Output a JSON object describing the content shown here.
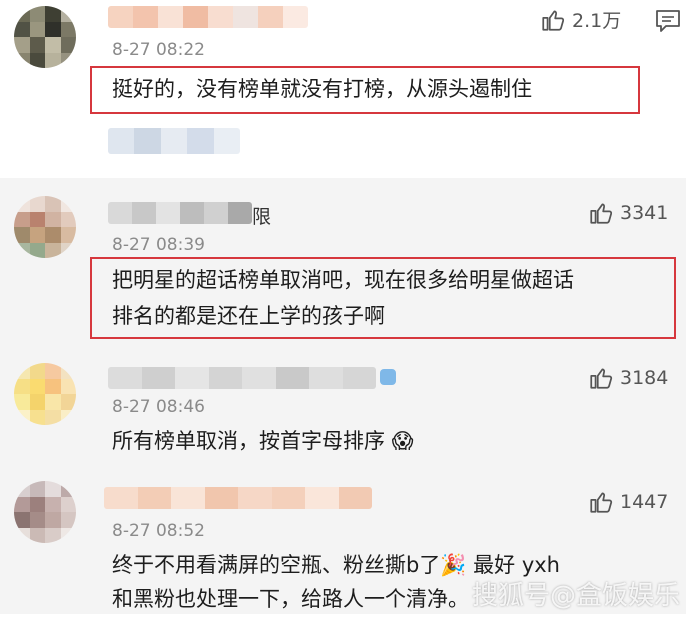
{
  "comments": [
    {
      "time": "8-27 08:22",
      "likes": "2.1万",
      "text_lines": [
        "挺好的，没有榜单就没有打榜，从源头遏制住"
      ]
    },
    {
      "time": "8-27 08:39",
      "likes": "3341",
      "name_suffix": "限",
      "text_lines": [
        "把明星的超话榜单取消吧，现在很多给明星做超话",
        "排名的都是还在上学的孩子啊"
      ]
    },
    {
      "time": "8-27 08:46",
      "likes": "3184",
      "text_lines": [
        "所有榜单取消，按首字母排序 😱"
      ]
    },
    {
      "time": "8-27 08:52",
      "likes": "1447",
      "text_lines": [
        "终于不用看满屏的空瓶、粉丝撕b了🎉   最好 yxh",
        "和黑粉也处理一下，给路人一个清净。"
      ]
    }
  ],
  "watermark": "搜狐号@盒饭娱乐",
  "icons": {
    "like": "thumbs-up-icon",
    "reply": "comment-icon"
  },
  "colors": {
    "highlight": "#d6373d",
    "meta": "#8a8a8a",
    "bg_alt": "#f4f4f4"
  }
}
